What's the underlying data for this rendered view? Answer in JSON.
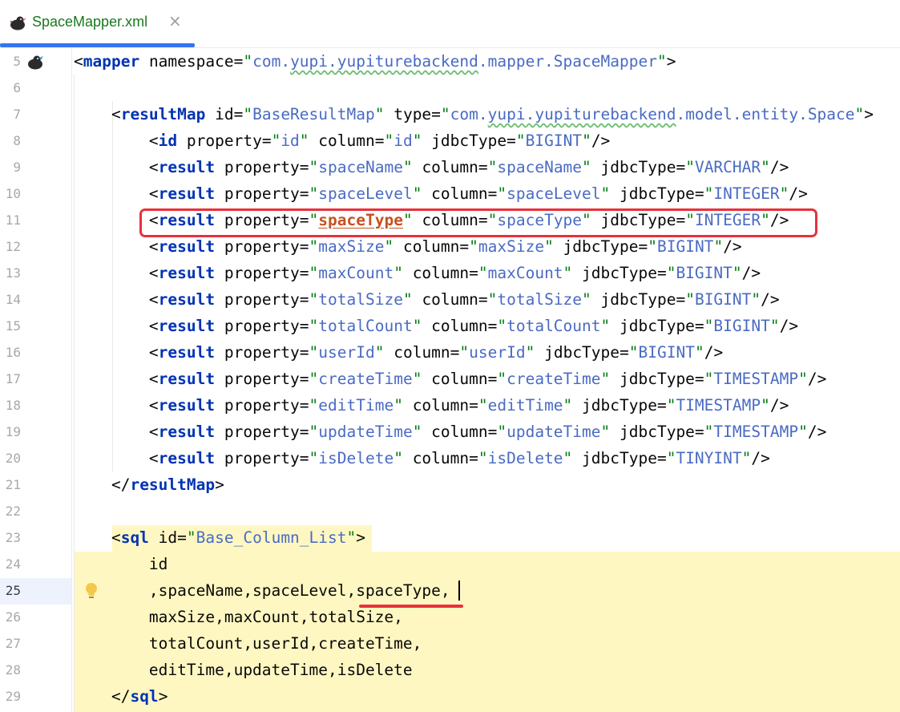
{
  "tab": {
    "title": "SpaceMapper.xml",
    "close": "×",
    "icon": "mybatis-bird-icon",
    "title_color": "#19791f"
  },
  "editor": {
    "current_line": 25,
    "highlighted_property": "spaceType",
    "lines": [
      {
        "n": 5,
        "segs": [
          [
            "p",
            "<"
          ],
          [
            "t",
            "mapper"
          ],
          [
            "a",
            " namespace="
          ],
          [
            "v",
            "\""
          ],
          [
            "vb",
            "com.",
            "ul0"
          ],
          [
            "vb",
            "yupi.yupiturebackend",
            "ul"
          ],
          [
            "vb",
            ".mapper.SpaceMapper"
          ],
          [
            "v",
            "\""
          ],
          [
            "p",
            ">"
          ]
        ]
      },
      {
        "n": 6,
        "segs": []
      },
      {
        "n": 7,
        "segs": [
          [
            "p",
            "    <"
          ],
          [
            "t",
            "resultMap"
          ],
          [
            "a",
            " id="
          ],
          [
            "v",
            "\""
          ],
          [
            "vb",
            "BaseResultMap"
          ],
          [
            "v",
            "\""
          ],
          [
            "a",
            " type="
          ],
          [
            "v",
            "\""
          ],
          [
            "vb",
            "com."
          ],
          [
            "vb",
            "yupi.yupiturebackend",
            "ul"
          ],
          [
            "vb",
            ".model.entity.Space"
          ],
          [
            "v",
            "\""
          ],
          [
            "p",
            ">"
          ]
        ]
      },
      {
        "n": 8,
        "segs": [
          [
            "p",
            "        <"
          ],
          [
            "t",
            "id"
          ],
          [
            "a",
            " property="
          ],
          [
            "v",
            "\""
          ],
          [
            "vb",
            "id"
          ],
          [
            "v",
            "\""
          ],
          [
            "a",
            " column="
          ],
          [
            "v",
            "\""
          ],
          [
            "vb",
            "id"
          ],
          [
            "v",
            "\""
          ],
          [
            "a",
            " jdbcType="
          ],
          [
            "v",
            "\""
          ],
          [
            "vb",
            "BIGINT"
          ],
          [
            "v",
            "\""
          ],
          [
            "p",
            "/>"
          ]
        ]
      },
      {
        "n": 9,
        "segs": [
          [
            "p",
            "        <"
          ],
          [
            "t",
            "result"
          ],
          [
            "a",
            " property="
          ],
          [
            "v",
            "\""
          ],
          [
            "vb",
            "spaceName"
          ],
          [
            "v",
            "\""
          ],
          [
            "a",
            " column="
          ],
          [
            "v",
            "\""
          ],
          [
            "vb",
            "spaceName"
          ],
          [
            "v",
            "\""
          ],
          [
            "a",
            " jdbcType="
          ],
          [
            "v",
            "\""
          ],
          [
            "vb",
            "VARCHAR"
          ],
          [
            "v",
            "\""
          ],
          [
            "p",
            "/>"
          ]
        ]
      },
      {
        "n": 10,
        "segs": [
          [
            "p",
            "        <"
          ],
          [
            "t",
            "result"
          ],
          [
            "a",
            " property="
          ],
          [
            "v",
            "\""
          ],
          [
            "vb",
            "spaceLevel"
          ],
          [
            "v",
            "\""
          ],
          [
            "a",
            " column="
          ],
          [
            "v",
            "\""
          ],
          [
            "vb",
            "spaceLevel"
          ],
          [
            "v",
            "\""
          ],
          [
            "a",
            " jdbcType="
          ],
          [
            "v",
            "\""
          ],
          [
            "vb",
            "INTEGER"
          ],
          [
            "v",
            "\""
          ],
          [
            "p",
            "/>"
          ]
        ]
      },
      {
        "n": 11,
        "segs": [
          [
            "p",
            "        <"
          ],
          [
            "t",
            "result"
          ],
          [
            "a",
            " property="
          ],
          [
            "v",
            "\""
          ],
          [
            "hv",
            "spaceType"
          ],
          [
            "v",
            "\""
          ],
          [
            "a",
            " column="
          ],
          [
            "v",
            "\""
          ],
          [
            "vb",
            "spaceType"
          ],
          [
            "v",
            "\""
          ],
          [
            "a",
            " jdbcType="
          ],
          [
            "v",
            "\""
          ],
          [
            "vb",
            "INTEGER"
          ],
          [
            "v",
            "\""
          ],
          [
            "p",
            "/>"
          ]
        ]
      },
      {
        "n": 12,
        "segs": [
          [
            "p",
            "        <"
          ],
          [
            "t",
            "result"
          ],
          [
            "a",
            " property="
          ],
          [
            "v",
            "\""
          ],
          [
            "vb",
            "maxSize"
          ],
          [
            "v",
            "\""
          ],
          [
            "a",
            " column="
          ],
          [
            "v",
            "\""
          ],
          [
            "vb",
            "maxSize"
          ],
          [
            "v",
            "\""
          ],
          [
            "a",
            " jdbcType="
          ],
          [
            "v",
            "\""
          ],
          [
            "vb",
            "BIGINT"
          ],
          [
            "v",
            "\""
          ],
          [
            "p",
            "/>"
          ]
        ]
      },
      {
        "n": 13,
        "segs": [
          [
            "p",
            "        <"
          ],
          [
            "t",
            "result"
          ],
          [
            "a",
            " property="
          ],
          [
            "v",
            "\""
          ],
          [
            "vb",
            "maxCount"
          ],
          [
            "v",
            "\""
          ],
          [
            "a",
            " column="
          ],
          [
            "v",
            "\""
          ],
          [
            "vb",
            "maxCount"
          ],
          [
            "v",
            "\""
          ],
          [
            "a",
            " jdbcType="
          ],
          [
            "v",
            "\""
          ],
          [
            "vb",
            "BIGINT"
          ],
          [
            "v",
            "\""
          ],
          [
            "p",
            "/>"
          ]
        ]
      },
      {
        "n": 14,
        "segs": [
          [
            "p",
            "        <"
          ],
          [
            "t",
            "result"
          ],
          [
            "a",
            " property="
          ],
          [
            "v",
            "\""
          ],
          [
            "vb",
            "totalSize"
          ],
          [
            "v",
            "\""
          ],
          [
            "a",
            " column="
          ],
          [
            "v",
            "\""
          ],
          [
            "vb",
            "totalSize"
          ],
          [
            "v",
            "\""
          ],
          [
            "a",
            " jdbcType="
          ],
          [
            "v",
            "\""
          ],
          [
            "vb",
            "BIGINT"
          ],
          [
            "v",
            "\""
          ],
          [
            "p",
            "/>"
          ]
        ]
      },
      {
        "n": 15,
        "segs": [
          [
            "p",
            "        <"
          ],
          [
            "t",
            "result"
          ],
          [
            "a",
            " property="
          ],
          [
            "v",
            "\""
          ],
          [
            "vb",
            "totalCount"
          ],
          [
            "v",
            "\""
          ],
          [
            "a",
            " column="
          ],
          [
            "v",
            "\""
          ],
          [
            "vb",
            "totalCount"
          ],
          [
            "v",
            "\""
          ],
          [
            "a",
            " jdbcType="
          ],
          [
            "v",
            "\""
          ],
          [
            "vb",
            "BIGINT"
          ],
          [
            "v",
            "\""
          ],
          [
            "p",
            "/>"
          ]
        ]
      },
      {
        "n": 16,
        "segs": [
          [
            "p",
            "        <"
          ],
          [
            "t",
            "result"
          ],
          [
            "a",
            " property="
          ],
          [
            "v",
            "\""
          ],
          [
            "vb",
            "userId"
          ],
          [
            "v",
            "\""
          ],
          [
            "a",
            " column="
          ],
          [
            "v",
            "\""
          ],
          [
            "vb",
            "userId"
          ],
          [
            "v",
            "\""
          ],
          [
            "a",
            " jdbcType="
          ],
          [
            "v",
            "\""
          ],
          [
            "vb",
            "BIGINT"
          ],
          [
            "v",
            "\""
          ],
          [
            "p",
            "/>"
          ]
        ]
      },
      {
        "n": 17,
        "segs": [
          [
            "p",
            "        <"
          ],
          [
            "t",
            "result"
          ],
          [
            "a",
            " property="
          ],
          [
            "v",
            "\""
          ],
          [
            "vb",
            "createTime"
          ],
          [
            "v",
            "\""
          ],
          [
            "a",
            " column="
          ],
          [
            "v",
            "\""
          ],
          [
            "vb",
            "createTime"
          ],
          [
            "v",
            "\""
          ],
          [
            "a",
            " jdbcType="
          ],
          [
            "v",
            "\""
          ],
          [
            "vb",
            "TIMESTAMP"
          ],
          [
            "v",
            "\""
          ],
          [
            "p",
            "/>"
          ]
        ]
      },
      {
        "n": 18,
        "segs": [
          [
            "p",
            "        <"
          ],
          [
            "t",
            "result"
          ],
          [
            "a",
            " property="
          ],
          [
            "v",
            "\""
          ],
          [
            "vb",
            "editTime"
          ],
          [
            "v",
            "\""
          ],
          [
            "a",
            " column="
          ],
          [
            "v",
            "\""
          ],
          [
            "vb",
            "editTime"
          ],
          [
            "v",
            "\""
          ],
          [
            "a",
            " jdbcType="
          ],
          [
            "v",
            "\""
          ],
          [
            "vb",
            "TIMESTAMP"
          ],
          [
            "v",
            "\""
          ],
          [
            "p",
            "/>"
          ]
        ]
      },
      {
        "n": 19,
        "segs": [
          [
            "p",
            "        <"
          ],
          [
            "t",
            "result"
          ],
          [
            "a",
            " property="
          ],
          [
            "v",
            "\""
          ],
          [
            "vb",
            "updateTime"
          ],
          [
            "v",
            "\""
          ],
          [
            "a",
            " column="
          ],
          [
            "v",
            "\""
          ],
          [
            "vb",
            "updateTime"
          ],
          [
            "v",
            "\""
          ],
          [
            "a",
            " jdbcType="
          ],
          [
            "v",
            "\""
          ],
          [
            "vb",
            "TIMESTAMP"
          ],
          [
            "v",
            "\""
          ],
          [
            "p",
            "/>"
          ]
        ]
      },
      {
        "n": 20,
        "segs": [
          [
            "p",
            "        <"
          ],
          [
            "t",
            "result"
          ],
          [
            "a",
            " property="
          ],
          [
            "v",
            "\""
          ],
          [
            "vb",
            "isDelete"
          ],
          [
            "v",
            "\""
          ],
          [
            "a",
            " column="
          ],
          [
            "v",
            "\""
          ],
          [
            "vb",
            "isDelete"
          ],
          [
            "v",
            "\""
          ],
          [
            "a",
            " jdbcType="
          ],
          [
            "v",
            "\""
          ],
          [
            "vb",
            "TINYINT"
          ],
          [
            "v",
            "\""
          ],
          [
            "p",
            "/>"
          ]
        ]
      },
      {
        "n": 21,
        "segs": [
          [
            "p",
            "    </"
          ],
          [
            "t",
            "resultMap"
          ],
          [
            "p",
            ">"
          ]
        ]
      },
      {
        "n": 22,
        "segs": []
      },
      {
        "n": 23,
        "segs": [
          [
            "p",
            "    <"
          ],
          [
            "t",
            "sql"
          ],
          [
            "a",
            " id="
          ],
          [
            "v",
            "\""
          ],
          [
            "vb",
            "Base_Column_List"
          ],
          [
            "v",
            "\""
          ],
          [
            "p",
            ">"
          ]
        ]
      },
      {
        "n": 24,
        "segs": [
          [
            "p",
            "        id"
          ]
        ]
      },
      {
        "n": 25,
        "segs": [
          [
            "p",
            "        ,spaceName,spaceLevel,spaceType,"
          ]
        ]
      },
      {
        "n": 26,
        "segs": [
          [
            "p",
            "        maxSize,maxCount,totalSize,"
          ]
        ]
      },
      {
        "n": 27,
        "segs": [
          [
            "p",
            "        totalCount,userId,createTime,"
          ]
        ]
      },
      {
        "n": 28,
        "segs": [
          [
            "p",
            "        editTime,updateTime,isDelete"
          ]
        ]
      },
      {
        "n": 29,
        "segs": [
          [
            "p",
            "    </"
          ],
          [
            "t",
            "sql"
          ],
          [
            "p",
            ">"
          ]
        ]
      }
    ]
  },
  "annotations": {
    "red_box_line": 11,
    "red_underline_line": 25,
    "red_color": "#e8313b",
    "highlight_color": "#fff7c2"
  }
}
